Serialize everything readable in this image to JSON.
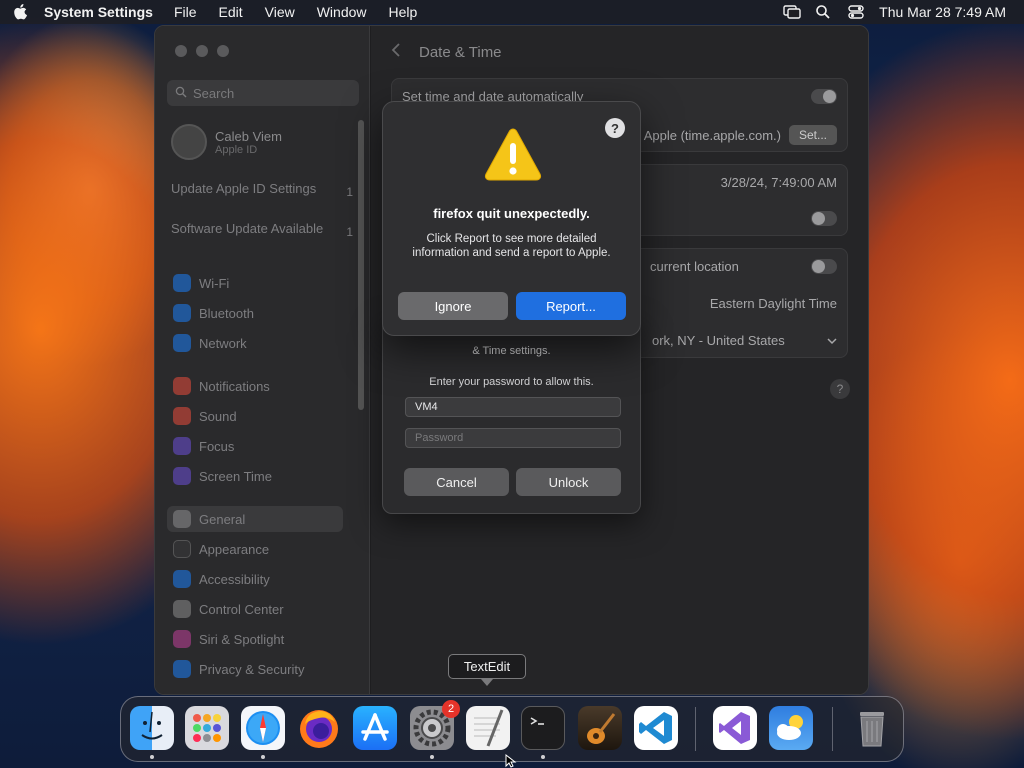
{
  "menubar": {
    "app_name": "System Settings",
    "menus": [
      "File",
      "Edit",
      "View",
      "Window",
      "Help"
    ],
    "clock": "Thu Mar 28  7:49 AM"
  },
  "settings": {
    "search_placeholder": "Search",
    "account_name": "Caleb Viem",
    "account_sub": "Apple ID",
    "notices": [
      {
        "label": "Update Apple ID Settings",
        "badge": "1"
      },
      {
        "label": "Software Update Available",
        "badge": "1"
      }
    ],
    "sidebar_items": [
      {
        "label": "Wi-Fi",
        "color": "#1a7cf5"
      },
      {
        "label": "Bluetooth",
        "color": "#1a7cf5"
      },
      {
        "label": "Network",
        "color": "#1a7cf5"
      },
      {
        "label": "Notifications",
        "color": "#e84a3c"
      },
      {
        "label": "Sound",
        "color": "#e84a3c"
      },
      {
        "label": "Focus",
        "color": "#6b4fd8"
      },
      {
        "label": "Screen Time",
        "color": "#6b4fd8"
      },
      {
        "label": "General",
        "color": "#8a8a8c"
      },
      {
        "label": "Appearance",
        "color": "#3a3a3c"
      },
      {
        "label": "Accessibility",
        "color": "#1a7cf5"
      },
      {
        "label": "Control Center",
        "color": "#8a8a8c"
      },
      {
        "label": "Siri & Spotlight",
        "color": "#c0409a"
      },
      {
        "label": "Privacy & Security",
        "color": "#1a7cf5"
      }
    ],
    "page_title": "Date & Time",
    "row_auto_time": "Set time and date automatically",
    "source_label": "Apple (time.apple.com.)",
    "set_button": "Set...",
    "datetime_value": "3/28/24, 7:49:00 AM",
    "location_label": "current location",
    "timezone_label": "Eastern Daylight Time",
    "city_label": "ork, NY - United States",
    "help": "?"
  },
  "unlock_dialog": {
    "message_partial": "& Time settings.",
    "prompt": "Enter your password to allow this.",
    "username": "VM4",
    "password_placeholder": "Password",
    "cancel": "Cancel",
    "unlock": "Unlock"
  },
  "crash_alert": {
    "help": "?",
    "title": "firefox quit unexpectedly.",
    "body": "Click Report to see more detailed information and send a report to Apple.",
    "ignore": "Ignore",
    "report": "Report..."
  },
  "tooltip": "TextEdit",
  "dock": {
    "settings_badge": "2",
    "apps": [
      {
        "name": "Finder",
        "color": "#2f8df5"
      },
      {
        "name": "Launchpad",
        "color": "#d9d9de"
      },
      {
        "name": "Safari",
        "color": "#f4f6fa"
      },
      {
        "name": "Firefox",
        "color": "#5b2fb5"
      },
      {
        "name": "App Store",
        "color": "#1b8cf5"
      },
      {
        "name": "System Settings",
        "color": "#8c8c90"
      },
      {
        "name": "TextEdit",
        "color": "#f2f2f2"
      },
      {
        "name": "Terminal",
        "color": "#1c1c1e"
      },
      {
        "name": "GarageBand",
        "color": "#3a2a1a"
      },
      {
        "name": "Visual Studio Code",
        "color": "#ffffff"
      },
      {
        "name": "Visual Studio",
        "color": "#ffffff"
      },
      {
        "name": "Weather",
        "color": "#3d8ce8"
      },
      {
        "name": "Trash",
        "color": "#6a6a6e"
      }
    ]
  }
}
